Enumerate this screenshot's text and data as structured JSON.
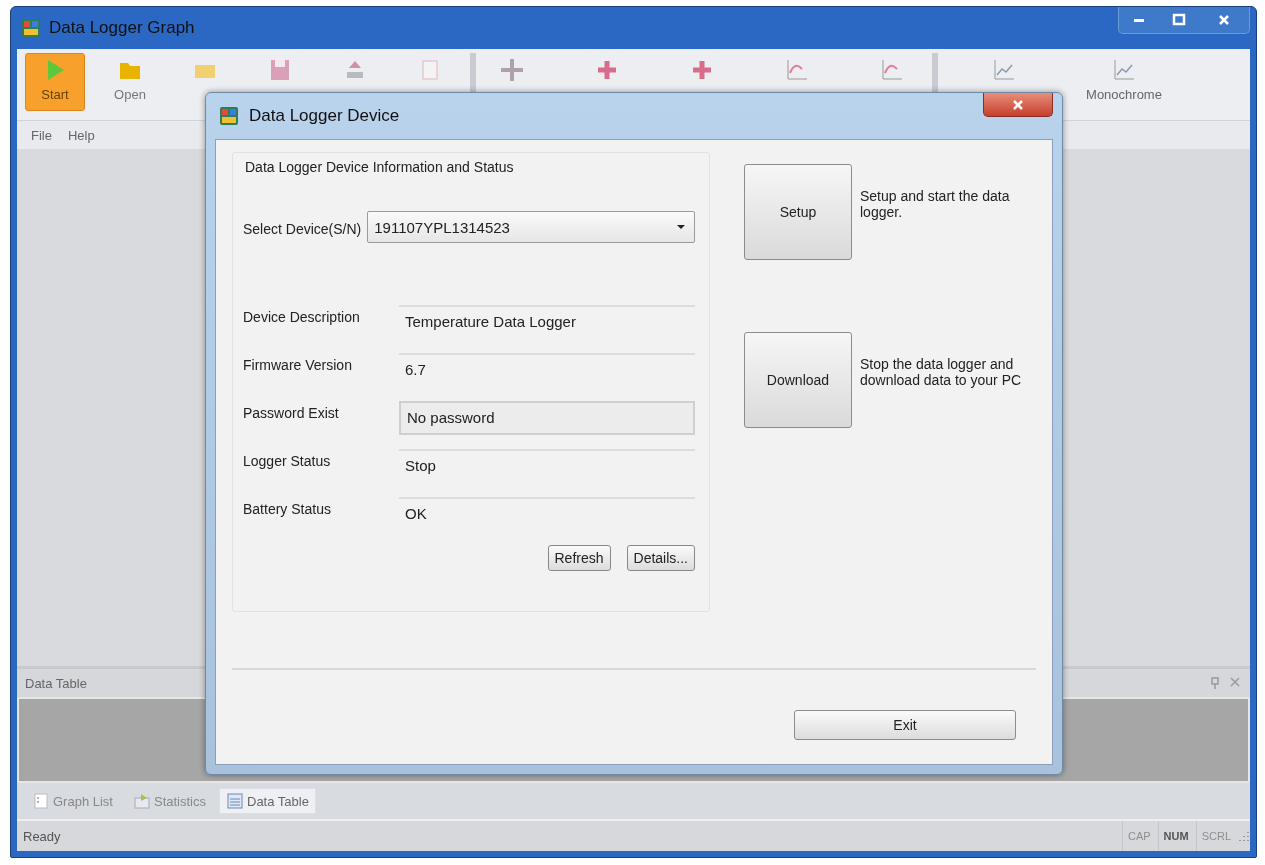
{
  "window": {
    "title": "Data Logger Graph"
  },
  "toolbar": {
    "left_buttons": [
      {
        "label": "Start",
        "selected": true
      },
      {
        "label": "Open",
        "selected": false
      }
    ],
    "right_buttons": [
      {
        "label": "Monochrome",
        "selected": false
      }
    ]
  },
  "menu": [
    "File",
    "Help"
  ],
  "data_table_panel": {
    "title": "Data Table"
  },
  "bottom_tabs": [
    {
      "label": "Graph List",
      "selected": false
    },
    {
      "label": "Statistics",
      "selected": false
    },
    {
      "label": "Data Table",
      "selected": true
    }
  ],
  "status_bar": {
    "text": "Ready",
    "indicators": [
      {
        "label": "CAP",
        "on": false
      },
      {
        "label": "NUM",
        "on": true
      },
      {
        "label": "SCRL",
        "on": false
      }
    ]
  },
  "dialog": {
    "title": "Data Logger Device",
    "group_title": "Data Logger Device Information and Status",
    "device_select": {
      "label": "Select Device(S/N)",
      "value": "191107YPL1314523"
    },
    "fields": [
      {
        "label": "Device Description",
        "value": "Temperature Data Logger",
        "kind": "readonly"
      },
      {
        "label": "Firmware Version",
        "value": "6.7",
        "kind": "readonly"
      },
      {
        "label": "Password Exist",
        "value": "No password",
        "kind": "box"
      },
      {
        "label": "Logger Status",
        "value": "Stop",
        "kind": "readonly"
      },
      {
        "label": "Battery Status",
        "value": "OK",
        "kind": "readonly"
      }
    ],
    "group_buttons": [
      "Refresh",
      "Details..."
    ],
    "actions": [
      {
        "label": "Setup",
        "description": "Setup and start the data logger."
      },
      {
        "label": "Download",
        "description": "Stop the data logger and download data to your PC"
      }
    ],
    "exit_button": "Exit"
  }
}
